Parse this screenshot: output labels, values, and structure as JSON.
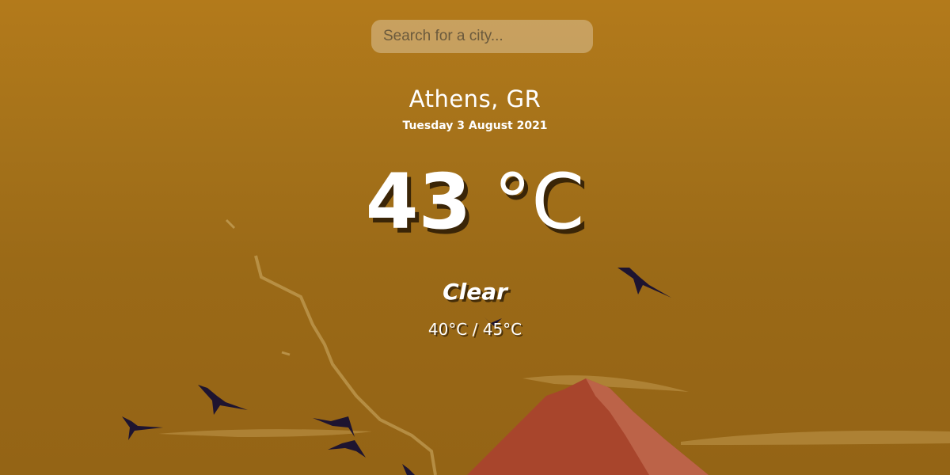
{
  "search": {
    "placeholder": "Search for a city...",
    "value": ""
  },
  "weather": {
    "location": "Athens, GR",
    "date": "Tuesday 3 August 2021",
    "temperature": "43",
    "unit": "°C",
    "condition": "Clear",
    "range": "40°C / 45°C"
  },
  "theme": {
    "background": "#9f6c18",
    "mountain": "#a8452c",
    "birds": "#1e1430"
  }
}
